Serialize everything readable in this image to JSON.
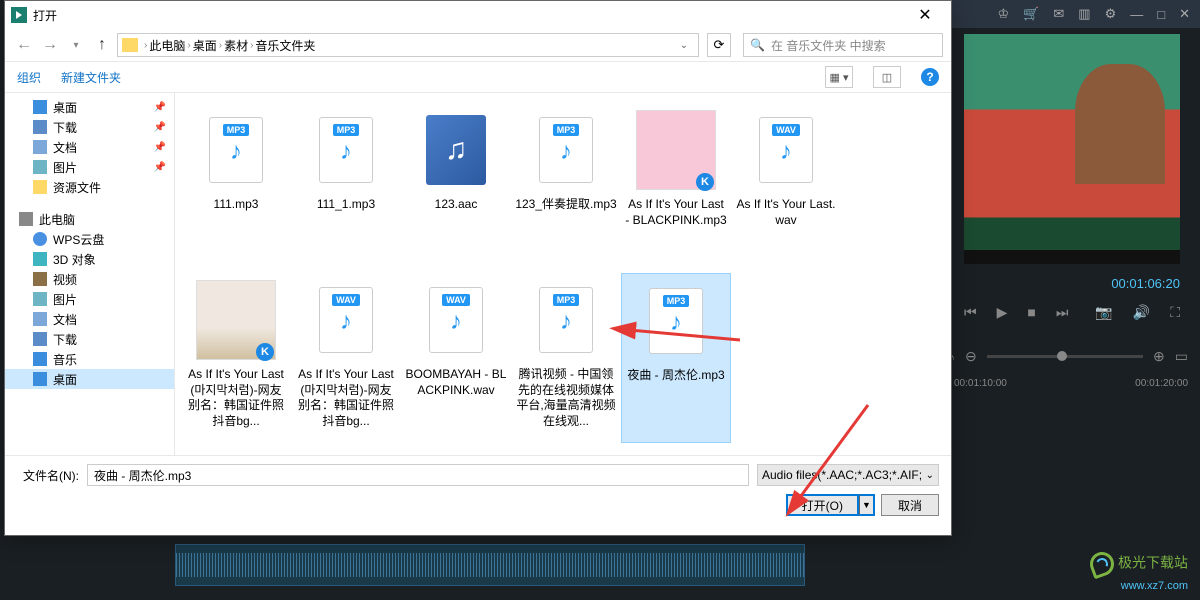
{
  "dialog": {
    "title": "打开",
    "breadcrumb": [
      "此电脑",
      "桌面",
      "素材",
      "音乐文件夹"
    ],
    "search_placeholder": "在 音乐文件夹 中搜索",
    "organize": "组织",
    "new_folder": "新建文件夹",
    "filename_label": "文件名(N):",
    "filename_value": "夜曲 - 周杰伦.mp3",
    "filter": "Audio files(*.AAC;*.AC3;*.AIF;",
    "open_btn": "打开(O)",
    "cancel_btn": "取消"
  },
  "sidebar": {
    "quick": [
      {
        "icon": "desktop",
        "label": "桌面",
        "pinned": true
      },
      {
        "icon": "download",
        "label": "下载",
        "pinned": true
      },
      {
        "icon": "doc",
        "label": "文档",
        "pinned": true
      },
      {
        "icon": "pic",
        "label": "图片",
        "pinned": true
      },
      {
        "icon": "folder",
        "label": "资源文件",
        "pinned": false
      }
    ],
    "pc_label": "此电脑",
    "pc": [
      {
        "icon": "wps",
        "label": "WPS云盘"
      },
      {
        "icon": "obj3d",
        "label": "3D 对象"
      },
      {
        "icon": "video",
        "label": "视频"
      },
      {
        "icon": "pic",
        "label": "图片"
      },
      {
        "icon": "doc",
        "label": "文档"
      },
      {
        "icon": "download",
        "label": "下载"
      },
      {
        "icon": "music",
        "label": "音乐"
      },
      {
        "icon": "desktop",
        "label": "桌面",
        "selected": true
      }
    ]
  },
  "files": [
    {
      "type": "mp3",
      "name": "111.mp3"
    },
    {
      "type": "mp3",
      "name": "111_1.mp3"
    },
    {
      "type": "aac",
      "name": "123.aac"
    },
    {
      "type": "mp3",
      "name": "123_伴奏提取.mp3"
    },
    {
      "type": "img-pink",
      "name": "As If It's Your Last - BLACKPINK.mp3",
      "badge": true
    },
    {
      "type": "wav",
      "name": "As If It's Your Last.wav"
    },
    {
      "type": "img-girl",
      "name": "As If It's Your Last(마지막처럼)-网友别名：韩国证件照抖音bg...",
      "badge": true
    },
    {
      "type": "wav",
      "name": "As If It's Your Last(마지막처럼)-网友别名：韩国证件照抖音bg..."
    },
    {
      "type": "wav",
      "name": "BOOMBAYAH - BLACKPINK.wav"
    },
    {
      "type": "mp3",
      "name": "腾讯视频 - 中国领先的在线视频媒体平台,海量高清视频在线观..."
    },
    {
      "type": "mp3",
      "name": "夜曲 - 周杰伦.mp3",
      "selected": true
    }
  ],
  "app": {
    "timecode_current": "00:01:06:20",
    "timeline_marks": [
      "00:01:10:00",
      "00:01:20:00"
    ]
  },
  "watermark": {
    "cn": "极光下载站",
    "en": "www.xz7.com"
  }
}
